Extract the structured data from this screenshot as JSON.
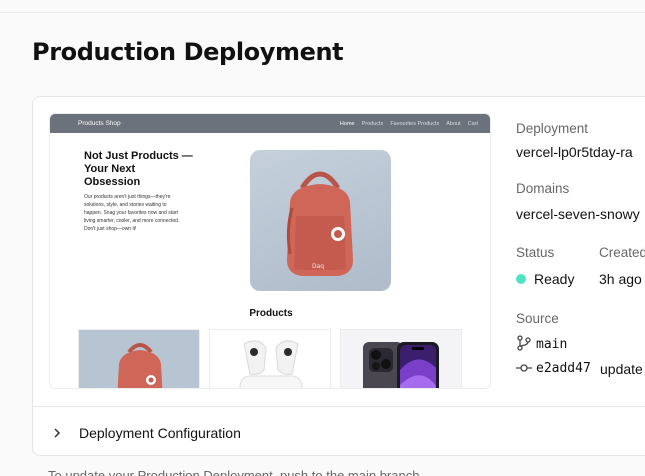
{
  "page": {
    "title": "Production Deployment"
  },
  "preview": {
    "nav": {
      "brand": "Products Shop",
      "links": [
        "Home",
        "Products",
        "Favourites Products",
        "About",
        "Cart"
      ],
      "active_index": 0
    },
    "hero": {
      "title": "Not Just Products — Your Next Obsession",
      "text": "Our products aren't just things—they're solutions, style, and stories waiting to happen. Snag your favorites now and start living smarter, cooler, and more connected. Don't just shop—own it!"
    },
    "products_title": "Products"
  },
  "info": {
    "deployment_label": "Deployment",
    "deployment_value": "vercel-lp0r5tday-ra",
    "domains_label": "Domains",
    "domains_value": "vercel-seven-snowy",
    "status_label": "Status",
    "status_value": "Ready",
    "status_color": "#50e3c2",
    "created_label": "Created",
    "created_value": "3h ago",
    "source_label": "Source",
    "branch": "main",
    "commit_hash": "e2add47",
    "commit_message": "update"
  },
  "config": {
    "label": "Deployment Configuration"
  },
  "footer": {
    "note": "To update your Production Deployment, push to the main branch."
  }
}
